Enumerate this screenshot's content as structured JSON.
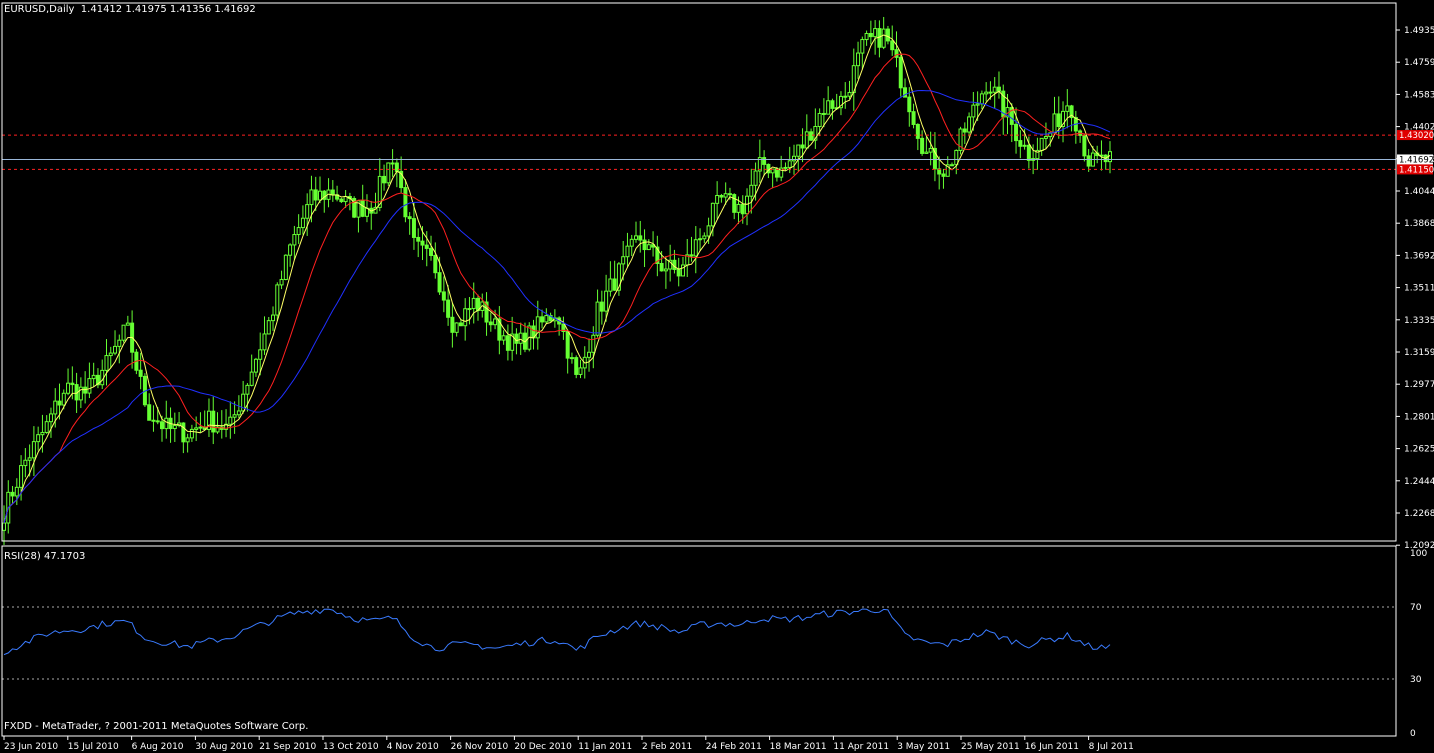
{
  "header": {
    "symbol": "EURUSD,Daily",
    "ohlc": "1.41412 1.41975 1.41356 1.41692"
  },
  "indicator": {
    "label": "RSI(28) 47.1703",
    "levels": [
      70,
      30
    ],
    "scale": [
      100,
      0
    ]
  },
  "footer": {
    "copyright": "FXDD - MetaTrader, ? 2001-2011 MetaQuotes Software Corp."
  },
  "colors": {
    "background": "#000000",
    "axis": "#ffffff",
    "candle": "#66ff33",
    "ma_fast": "#ffff66",
    "ma_mid": "#ff2020",
    "ma_slow": "#2030ff",
    "rsi": "#3a7bff",
    "current_price_line": "#9ab6d8",
    "hline": "#ff2020",
    "price_tag": "#e00000"
  },
  "chart_data": [
    {
      "type": "candlestick",
      "title": "EURUSD,Daily",
      "y_ticks": [
        "1.49355",
        "1.47595",
        "1.45835",
        "1.44020",
        "1.42260",
        "1.40445",
        "1.38685",
        "1.36925",
        "1.35110",
        "1.33350",
        "1.31590",
        "1.29775",
        "1.28015",
        "1.26255",
        "1.24440",
        "1.22680",
        "1.20920"
      ],
      "ylim": [
        1.2092,
        1.5021
      ],
      "x_ticks": [
        "23 Jun 2010",
        "15 Jul 2010",
        "6 Aug 2010",
        "30 Aug 2010",
        "21 Sep 2010",
        "13 Oct 2010",
        "4 Nov 2010",
        "26 Nov 2010",
        "20 Dec 2010",
        "11 Jan 2011",
        "2 Feb 2011",
        "24 Feb 2011",
        "18 Mar 2011",
        "11 Apr 2011",
        "3 May 2011",
        "25 May 2011",
        "16 Jun 2011",
        "8 Jul 2011"
      ],
      "current_price": 1.41692,
      "horizontal_lines": [
        {
          "price": 1.4302,
          "label": "1.43020"
        },
        {
          "price": 1.4115,
          "label": "1.41150"
        }
      ],
      "price_tags": [
        "1.43020",
        "1.41692",
        "1.41150"
      ],
      "close_path": [
        [
          "23 Jun 2010",
          1.225
        ],
        [
          "1 Jul 2010",
          1.252
        ],
        [
          "8 Jul 2010",
          1.27
        ],
        [
          "15 Jul 2010",
          1.293
        ],
        [
          "23 Jul 2010",
          1.29
        ],
        [
          "30 Jul 2010",
          1.305
        ],
        [
          "6 Aug 2010",
          1.325
        ],
        [
          "13 Aug 2010",
          1.28
        ],
        [
          "20 Aug 2010",
          1.27
        ],
        [
          "27 Aug 2010",
          1.268
        ],
        [
          "30 Aug 2010",
          1.275
        ],
        [
          "6 Sep 2010",
          1.27
        ],
        [
          "13 Sep 2010",
          1.3
        ],
        [
          "21 Sep 2010",
          1.33
        ],
        [
          "28 Sep 2010",
          1.37
        ],
        [
          "6 Oct 2010",
          1.395
        ],
        [
          "13 Oct 2010",
          1.4
        ],
        [
          "20 Oct 2010",
          1.39
        ],
        [
          "27 Oct 2010",
          1.392
        ],
        [
          "4 Nov 2010",
          1.42
        ],
        [
          "11 Nov 2010",
          1.37
        ],
        [
          "18 Nov 2010",
          1.36
        ],
        [
          "26 Nov 2010",
          1.325
        ],
        [
          "3 Dec 2010",
          1.34
        ],
        [
          "10 Dec 2010",
          1.325
        ],
        [
          "20 Dec 2010",
          1.315
        ],
        [
          "27 Dec 2010",
          1.325
        ],
        [
          "3 Jan 2011",
          1.335
        ],
        [
          "11 Jan 2011",
          1.295
        ],
        [
          "18 Jan 2011",
          1.335
        ],
        [
          "25 Jan 2011",
          1.355
        ],
        [
          "2 Feb 2011",
          1.375
        ],
        [
          "9 Feb 2011",
          1.36
        ],
        [
          "16 Feb 2011",
          1.355
        ],
        [
          "24 Feb 2011",
          1.375
        ],
        [
          "3 Mar 2011",
          1.395
        ],
        [
          "10 Mar 2011",
          1.39
        ],
        [
          "18 Mar 2011",
          1.415
        ],
        [
          "25 Mar 2011",
          1.41
        ],
        [
          "1 Apr 2011",
          1.425
        ],
        [
          "11 Apr 2011",
          1.445
        ],
        [
          "18 Apr 2011",
          1.45
        ],
        [
          "25 Apr 2011",
          1.48
        ],
        [
          "29 Apr 2011",
          1.485
        ],
        [
          "3 May 2011",
          1.455
        ],
        [
          "10 May 2011",
          1.42
        ],
        [
          "18 May 2011",
          1.41
        ],
        [
          "25 May 2011",
          1.435
        ],
        [
          "31 May 2011",
          1.46
        ],
        [
          "8 Jun 2011",
          1.44
        ],
        [
          "16 Jun 2011",
          1.42
        ],
        [
          "23 Jun 2011",
          1.43
        ],
        [
          "30 Jun 2011",
          1.45
        ],
        [
          "8 Jul 2011",
          1.415
        ],
        [
          "13 Jul 2011",
          1.4169
        ]
      ]
    },
    {
      "type": "line",
      "title": "RSI(28) 47.1703",
      "ylim": [
        0,
        100
      ],
      "levels": [
        70,
        30
      ],
      "series": [
        {
          "values": [
            45,
            50,
            55,
            57,
            58,
            61,
            62,
            52,
            50,
            48,
            51,
            53,
            58,
            62,
            66,
            68,
            69,
            64,
            62,
            64,
            53,
            47,
            49,
            49,
            47,
            49,
            51,
            52,
            46,
            54,
            58,
            61,
            59,
            56,
            60,
            61,
            60,
            64,
            63,
            64,
            66,
            67,
            68,
            69,
            54,
            50,
            49,
            53,
            56,
            52,
            49,
            52,
            54,
            48,
            47.1703
          ]
        }
      ]
    }
  ]
}
